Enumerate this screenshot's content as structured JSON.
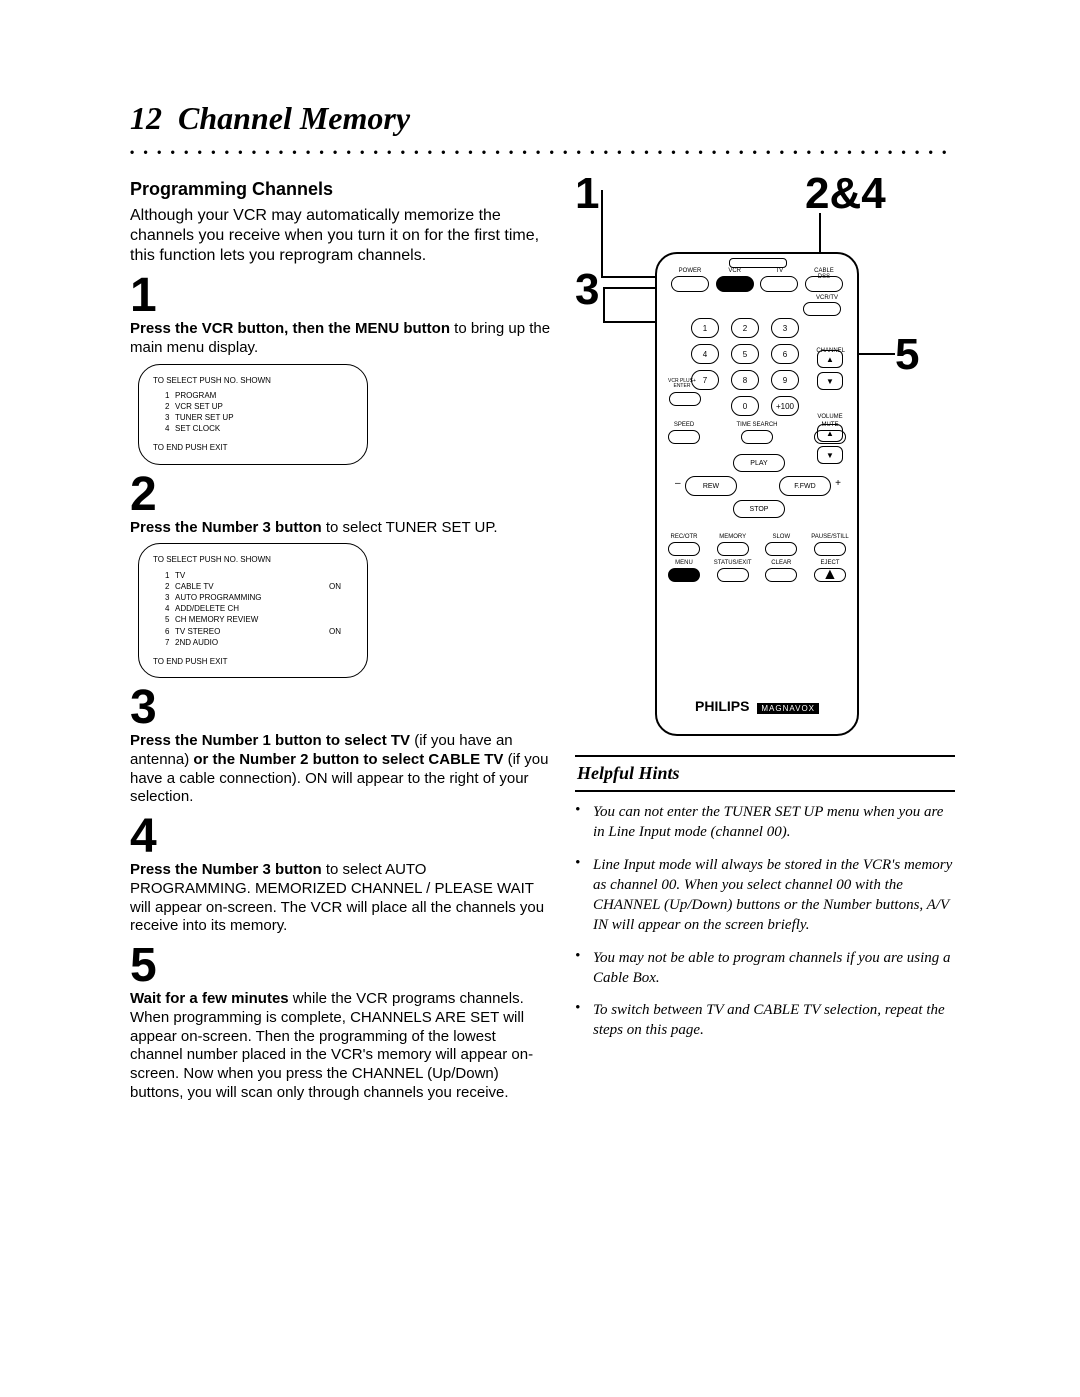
{
  "page_number": "12",
  "page_title": "Channel Memory",
  "subheading": "Programming Channels",
  "intro": "Although your VCR may automatically memorize the channels you receive when you turn it on for the first time, this function lets you reprogram channels.",
  "steps": [
    {
      "num": "1",
      "body_html": "<b>Press the VCR button, then the MENU button</b> to bring up the main menu display."
    },
    {
      "num": "2",
      "body_html": "<b>Press the Number 3 button</b> to select TUNER SET UP."
    },
    {
      "num": "3",
      "body_html": "<b>Press the Number 1 button to select TV</b> (if you have an antenna) <b>or the Number 2 button to select CABLE TV</b> (if you have a cable connection). ON will appear to the right of your selection."
    },
    {
      "num": "4",
      "body_html": "<b>Press the Number 3 button</b> to select AUTO PROGRAMMING. MEMORIZED CHANNEL / PLEASE WAIT will appear on-screen. The VCR will place all the channels you receive into its memory."
    },
    {
      "num": "5",
      "body_html": "<b>Wait for a few minutes</b> while the VCR programs channels. When programming is complete, CHANNELS ARE SET will appear on-screen. Then the programming of the lowest channel number placed in the VCR's memory will appear on-screen. Now when you press the CHANNEL (Up/Down) buttons, you will scan only through channels you receive."
    }
  ],
  "menu1": {
    "header": "TO SELECT PUSH NO. SHOWN",
    "options": [
      {
        "k": "1",
        "v": "PROGRAM",
        "s": ""
      },
      {
        "k": "2",
        "v": "VCR SET UP",
        "s": ""
      },
      {
        "k": "3",
        "v": "TUNER SET UP",
        "s": ""
      },
      {
        "k": "4",
        "v": "SET CLOCK",
        "s": ""
      }
    ],
    "footer": "TO END PUSH EXIT"
  },
  "menu2": {
    "header": "TO SELECT PUSH NO. SHOWN",
    "options": [
      {
        "k": "1",
        "v": "TV",
        "s": ""
      },
      {
        "k": "2",
        "v": "CABLE TV",
        "s": "ON"
      },
      {
        "k": "3",
        "v": "AUTO PROGRAMMING",
        "s": ""
      },
      {
        "k": "4",
        "v": "ADD/DELETE CH",
        "s": ""
      },
      {
        "k": "5",
        "v": "CH MEMORY REVIEW",
        "s": ""
      },
      {
        "k": "6",
        "v": "TV STEREO",
        "s": "ON"
      },
      {
        "k": "7",
        "v": "2ND AUDIO",
        "s": ""
      }
    ],
    "footer": "TO END PUSH EXIT"
  },
  "callouts": {
    "one": "1",
    "two_four": "2&4",
    "three": "3",
    "five": "5"
  },
  "remote": {
    "top_row": [
      "POWER",
      "VCR",
      "TV",
      "CABLE\nDSS"
    ],
    "vcrtv": "VCR/TV",
    "keypad": [
      "1",
      "2",
      "3",
      "4",
      "5",
      "6",
      "7",
      "8",
      "9",
      "",
      "0",
      "+100"
    ],
    "vcrplus": "VCR PLUS+\nENTER",
    "channel_label": "CHANNEL",
    "channel_arrows": [
      "▲",
      "▼"
    ],
    "func_row": [
      "SPEED",
      "TIME SEARCH",
      "MUTE"
    ],
    "volume_label": "VOLUME",
    "volume_arrows": [
      "▲",
      "▼"
    ],
    "transport": {
      "play": "PLAY",
      "rew": "REW",
      "ffwd": "F.FWD",
      "stop": "STOP",
      "minus": "–",
      "plus": "+"
    },
    "row4": [
      "REC/OTR",
      "MEMORY",
      "SLOW",
      "PAUSE/STILL"
    ],
    "row5": [
      "MENU",
      "STATUS/EXIT",
      "CLEAR",
      "EJECT"
    ],
    "brand": "PHILIPS",
    "brand_sub": "MAGNAVOX"
  },
  "hints_title": "Helpful Hints",
  "hints": [
    "You can not enter the TUNER SET UP menu when you are in Line Input mode (channel 00).",
    "Line Input mode will always be stored in the VCR's memory as channel 00. When you select channel 00 with the CHANNEL (Up/Down) buttons or the Number buttons, A/V IN will appear on the screen briefly.",
    "You may not be able to program channels if you are using a Cable Box.",
    "To switch between TV and CABLE TV selection, repeat the steps on this page."
  ]
}
